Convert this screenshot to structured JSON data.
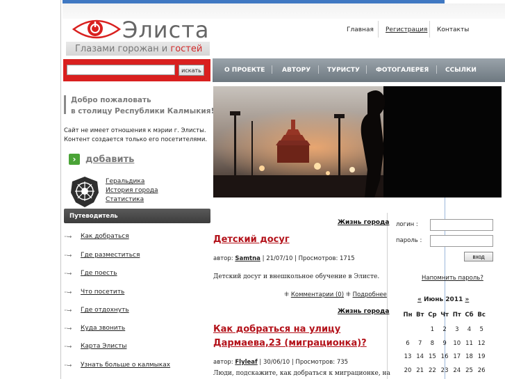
{
  "site": {
    "logo_title": "Элиста",
    "slogan_plain": "Глазами горожан и ",
    "slogan_accent": "гостей"
  },
  "top_links": [
    "Главная",
    "Регистрация",
    "Контакты"
  ],
  "search": {
    "button_label": "искать",
    "value": ""
  },
  "nav": [
    "О ПРОЕКТЕ",
    "АВТОРУ",
    "ТУРИСТУ",
    "ФОТОГАЛЕРЕЯ",
    "ССЫЛКИ"
  ],
  "welcome": {
    "line1": "Добро пожаловать",
    "line2": "в столицу Республики Калмыкия!"
  },
  "disclaimer": {
    "line1": "Сайт не имеет отношения к мэрии г. Элисты.",
    "line2": "Контент создается только его посетителями."
  },
  "add_label": "добавить",
  "emblem_links": [
    "Геральдика",
    "История города",
    "Статистика"
  ],
  "guide": {
    "title": "Путеводитель",
    "arrow": "···→",
    "items": [
      "Как добраться",
      "Где разместиться",
      "Где поесть",
      "Что посетить",
      "Где отдохнуть",
      "Куда звонить",
      "Карта Элисты",
      "Узнать больше о калмыках"
    ]
  },
  "articles": [
    {
      "category": "Жизнь города",
      "title": "Детский досуг",
      "meta_prefix": "автор: ",
      "author": "Samtna",
      "meta_suffix": " | 21/07/10 | Просмотров: 1715",
      "excerpt": "Детский досуг и внешкольное обучение в Элисте.",
      "comments": "Комментарии (0)",
      "more": "Подробнее"
    },
    {
      "category": "Жизнь города",
      "title_line1": "Как добраться на улицу",
      "title_line2": "Дармаева,23 (миграционка)?",
      "meta_prefix": "автор: ",
      "author": "Flyleaf",
      "meta_suffix": " | 30/06/10 | Просмотров: 735",
      "excerpt": "Люди, подскажите, как добраться к миграционке, на"
    }
  ],
  "login": {
    "login_label": "логин :",
    "password_label": "пароль :",
    "button": "вход",
    "remind": "Напомнить пароль?"
  },
  "calendar": {
    "prev": "«",
    "month": "Июнь 2011",
    "next": "»",
    "weekdays": [
      "Пн",
      "Вт",
      "Ср",
      "Чт",
      "Пт",
      "Сб",
      "Вс"
    ],
    "weeks": [
      [
        "",
        "",
        "1",
        "2",
        "3",
        "4",
        "5"
      ],
      [
        "6",
        "7",
        "8",
        "9",
        "10",
        "11",
        "12"
      ],
      [
        "13",
        "14",
        "15",
        "16",
        "17",
        "18",
        "19"
      ],
      [
        "20",
        "21",
        "22",
        "23",
        "24",
        "25",
        "26"
      ]
    ]
  },
  "colors": {
    "brand_red": "#d9201f",
    "nav_gray": "#7d878f",
    "title_red": "#b3121a",
    "accent_blue": "#3f78c2"
  }
}
